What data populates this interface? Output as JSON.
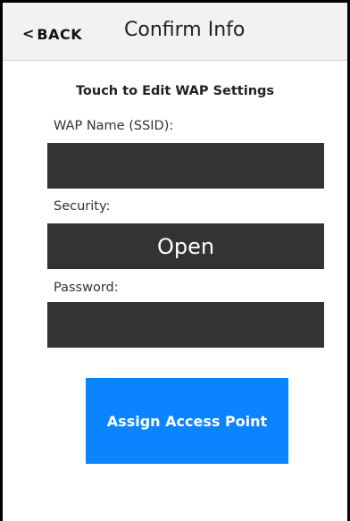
{
  "header": {
    "back_chevron": "<",
    "back_label": "BACK",
    "title": "Confirm Info"
  },
  "form": {
    "heading": "Touch to Edit WAP Settings",
    "ssid_label": "WAP Name (SSID):",
    "ssid_value": "",
    "security_label": "Security:",
    "security_value": "Open",
    "password_label": "Password:",
    "password_value": ""
  },
  "actions": {
    "assign_label": "Assign Access Point"
  },
  "colors": {
    "accent": "#0a84ff",
    "field_bg": "#333333",
    "header_bg": "#f2f2f2"
  }
}
